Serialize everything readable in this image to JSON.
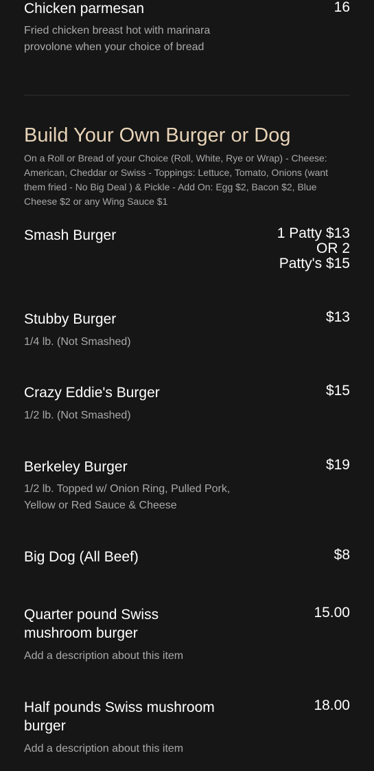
{
  "top_item": {
    "name": "Chicken parmesan",
    "description": "Fried chicken breast hot with marinara provolone when your choice of bread",
    "price": "16"
  },
  "section": {
    "title": "Build Your Own Burger or Dog",
    "description": "On a Roll or Bread of your Choice (Roll, White, Rye or Wrap) - Cheese: American, Cheddar or Swiss - Toppings: Lettuce, Tomato, Onions (want them fried - No Big Deal ) & Pickle - Add On: Egg $2, Bacon $2, Blue Cheese $2 or any Wing Sauce $1"
  },
  "items": [
    {
      "name": "Smash Burger",
      "description": "",
      "price_lines": [
        "1 Patty $13",
        "OR 2",
        "Patty's $15"
      ]
    },
    {
      "name": "Stubby Burger",
      "description": "1/4 lb. (Not Smashed)",
      "price": "$13"
    },
    {
      "name": "Crazy Eddie's Burger",
      "description": "1/2 lb. (Not Smashed)",
      "price": "$15"
    },
    {
      "name": "Berkeley Burger",
      "description": "1/2 lb. Topped w/ Onion Ring, Pulled Pork, Yellow or Red Sauce & Cheese",
      "price": "$19"
    },
    {
      "name": "Big Dog (All Beef)",
      "description": "",
      "price": "$8"
    },
    {
      "name": "Quarter pound Swiss mushroom burger",
      "description": "Add a description about this item",
      "price": "15.00"
    },
    {
      "name": "Half pounds Swiss mushroom burger",
      "description": "Add a description about this item",
      "price": "18.00"
    }
  ]
}
